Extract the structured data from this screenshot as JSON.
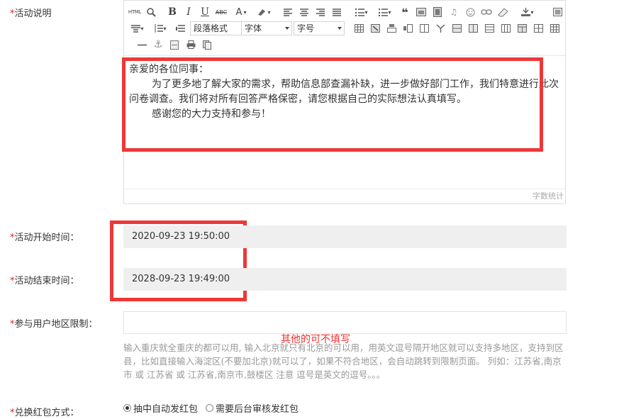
{
  "labels": {
    "activity_desc": "活动说明",
    "start_time": "活动开始时间：",
    "end_time": "活动结束时间：",
    "region_limit": "参与用户地区限制：",
    "redpack_method": "兑换红包方式："
  },
  "required_mark": "*",
  "editor": {
    "select_paragraph": "段落格式",
    "select_font": "字体",
    "select_size": "字号",
    "html_label": "HTML",
    "content": {
      "greeting": "亲爱的各位同事：",
      "body": "为了更多地了解大家的需求，帮助信息部查漏补缺，进一步做好部门工作，我们特意进行此次问卷调查。我们将对所有回答严格保密，请您根据自己的实际想法认真填写。",
      "thanks": "感谢您的大力支持和参与！"
    },
    "word_count": "字数统计"
  },
  "start_time_value": "2020-09-23 19:50:00",
  "end_time_value": "2028-09-23 19:49:00",
  "region_input_value": "",
  "annotation": "其他的可不填写",
  "region_hint": "输入重庆就全重庆的都可以用, 输入北京就只有北京的可以用，用英文逗号隔开地区就可以支持多地区，支持到区县，比如直接输入海淀区(不要加北京)就可以了，如果不符合地区，会自动跳转到限制页面。 列如：江苏省,南京市 或 江苏省 或 江苏省,南京市,鼓楼区 注意 逗号是英文的逗号。。。",
  "radio_options": [
    {
      "label": "抽中自动发红包",
      "selected": true
    },
    {
      "label": "需要后台审核发红包",
      "selected": false
    }
  ],
  "highlight_color": "#ee3838"
}
